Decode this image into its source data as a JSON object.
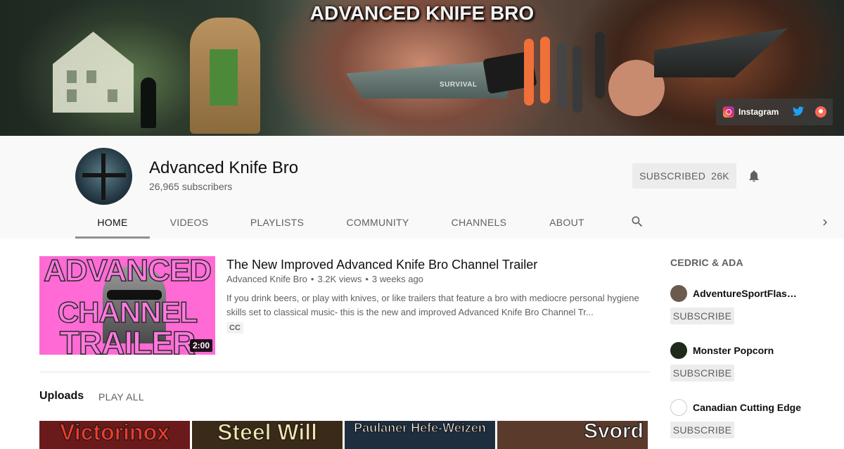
{
  "banner": {
    "title": "ADVANCED KNIFE BRO",
    "knife_stamp": "SURVIVAL",
    "links": {
      "instagram_label": "Instagram"
    }
  },
  "channel": {
    "name": "Advanced Knife Bro",
    "subscribers_text": "26,965 subscribers",
    "subscribe_button": {
      "label": "SUBSCRIBED",
      "count": "26K"
    }
  },
  "tabs": [
    {
      "label": "HOME",
      "active": true
    },
    {
      "label": "VIDEOS",
      "active": false
    },
    {
      "label": "PLAYLISTS",
      "active": false
    },
    {
      "label": "COMMUNITY",
      "active": false
    },
    {
      "label": "CHANNELS",
      "active": false
    },
    {
      "label": "ABOUT",
      "active": false
    }
  ],
  "featured": {
    "thumbnail_words": [
      "ADVANCED",
      "CHANNEL",
      "TRAILER"
    ],
    "duration": "2:00",
    "title": "The New Improved Advanced Knife Bro Channel Trailer",
    "channel": "Advanced Knife Bro",
    "views": "3.2K views",
    "age": "3 weeks ago",
    "description": "If you drink beers, or play with knives, or like trailers that feature a bro with mediocre personal hygiene skills set to classical music- this is the new and improved Advanced Knife Bro Channel Tr...",
    "cc": "CC"
  },
  "uploads": {
    "title": "Uploads",
    "play_all": "PLAY ALL",
    "thumbnails": [
      {
        "text": "Victorinox",
        "color": "#ff3a2b",
        "bg": "#6a1a1a"
      },
      {
        "text": "Steel Will",
        "color": "#f5e6a8",
        "bg": "#3a2a1a"
      },
      {
        "text": "Paulaner Hefe-Weizen",
        "color": "#ffffff",
        "bg": "#1e2e3e"
      },
      {
        "text": "Svord",
        "color": "#ffffff",
        "bg": "#5a3a2a"
      }
    ]
  },
  "sidebar": {
    "heading": "CEDRIC & ADA",
    "channels": [
      {
        "name": "AdventureSportFlashlights",
        "button": "SUBSCRIBE",
        "avatar_color": "#6d5a4e"
      },
      {
        "name": "Monster Popcorn",
        "button": "SUBSCRIBE",
        "avatar_color": "#1f2a1a"
      },
      {
        "name": "Canadian Cutting Edge",
        "button": "SUBSCRIBE",
        "avatar_color": "#ffffff"
      }
    ]
  }
}
